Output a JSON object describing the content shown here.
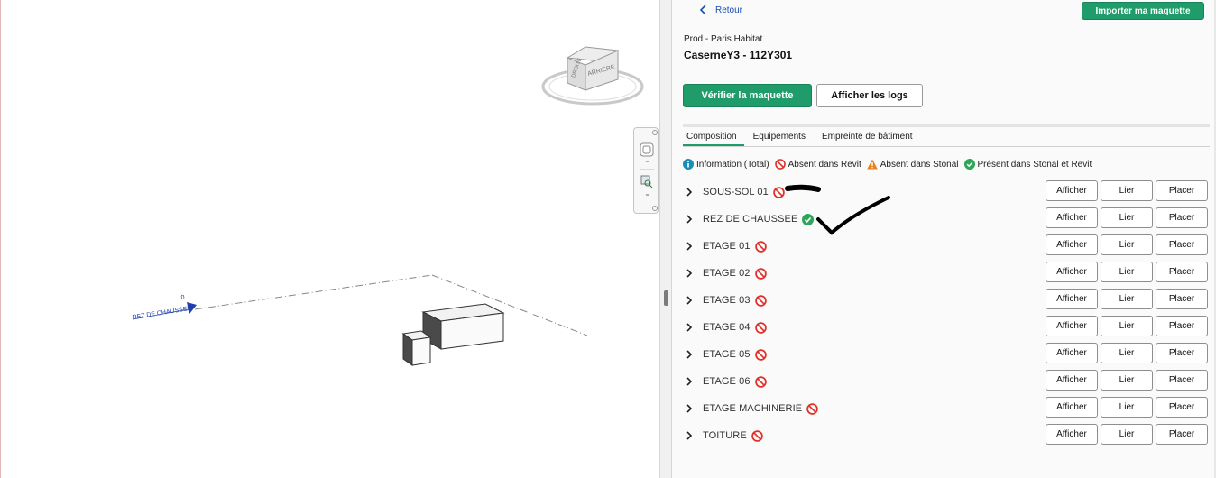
{
  "viewport": {
    "level_label": "REZ DE CHAUSSEE",
    "level_elevation": "0",
    "viewcube": {
      "top_face": "DROITE",
      "side_face": "ARRIÈRE"
    }
  },
  "header": {
    "back_label": "Retour",
    "import_label": "Importer ma maquette",
    "organization": "Prod - Paris Habitat",
    "project": "CaserneY3 - 112Y301"
  },
  "actions": {
    "verify_label": "Vérifier la maquette",
    "logs_label": "Afficher les logs"
  },
  "tabs": [
    {
      "label": "Composition",
      "active": true
    },
    {
      "label": "Equipements",
      "active": false
    },
    {
      "label": "Empreinte de bâtiment",
      "active": false
    }
  ],
  "legend": [
    {
      "icon": "info-icon",
      "label": "Information (Total)",
      "color": "#1a8fb5"
    },
    {
      "icon": "absent-revit-icon",
      "label": "Absent dans Revit",
      "color": "#e0312b"
    },
    {
      "icon": "absent-stonal-icon",
      "label": "Absent dans Stonal",
      "color": "#e6821e"
    },
    {
      "icon": "present-both-icon",
      "label": "Présent dans Stonal et Revit",
      "color": "#2da55a"
    }
  ],
  "levels": [
    {
      "name": "SOUS-SOL 01",
      "status": "absent"
    },
    {
      "name": "REZ DE CHAUSSEE",
      "status": "present"
    },
    {
      "name": "ETAGE 01",
      "status": "absent"
    },
    {
      "name": "ETAGE 02",
      "status": "absent"
    },
    {
      "name": "ETAGE 03",
      "status": "absent"
    },
    {
      "name": "ETAGE 04",
      "status": "absent"
    },
    {
      "name": "ETAGE 05",
      "status": "absent"
    },
    {
      "name": "ETAGE 06",
      "status": "absent"
    },
    {
      "name": "ETAGE MACHINERIE",
      "status": "absent"
    },
    {
      "name": "TOITURE",
      "status": "absent"
    }
  ],
  "row_actions": {
    "show": "Afficher",
    "link": "Lier",
    "place": "Placer"
  },
  "colors": {
    "accent": "#1f9c69",
    "link": "#1a4fb5",
    "absent": "#e0312b",
    "present": "#2da55a"
  }
}
